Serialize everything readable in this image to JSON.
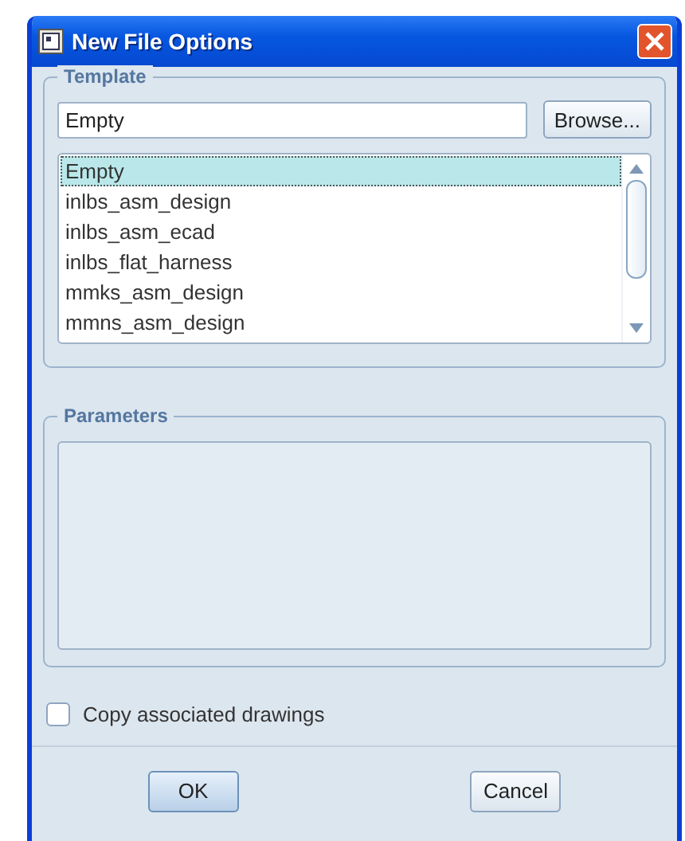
{
  "window": {
    "title": "New File Options"
  },
  "template": {
    "legend": "Template",
    "value": "Empty",
    "browse_button": "Browse...",
    "items": [
      {
        "label": "Empty",
        "selected": true
      },
      {
        "label": "inlbs_asm_design",
        "selected": false
      },
      {
        "label": "inlbs_asm_ecad",
        "selected": false
      },
      {
        "label": "inlbs_flat_harness",
        "selected": false
      },
      {
        "label": "mmks_asm_design",
        "selected": false
      },
      {
        "label": "mmns_asm_design",
        "selected": false
      }
    ]
  },
  "parameters": {
    "legend": "Parameters"
  },
  "copy_drawings": {
    "label": "Copy associated drawings",
    "checked": false
  },
  "buttons": [
    "OK",
    "Cancel"
  ]
}
